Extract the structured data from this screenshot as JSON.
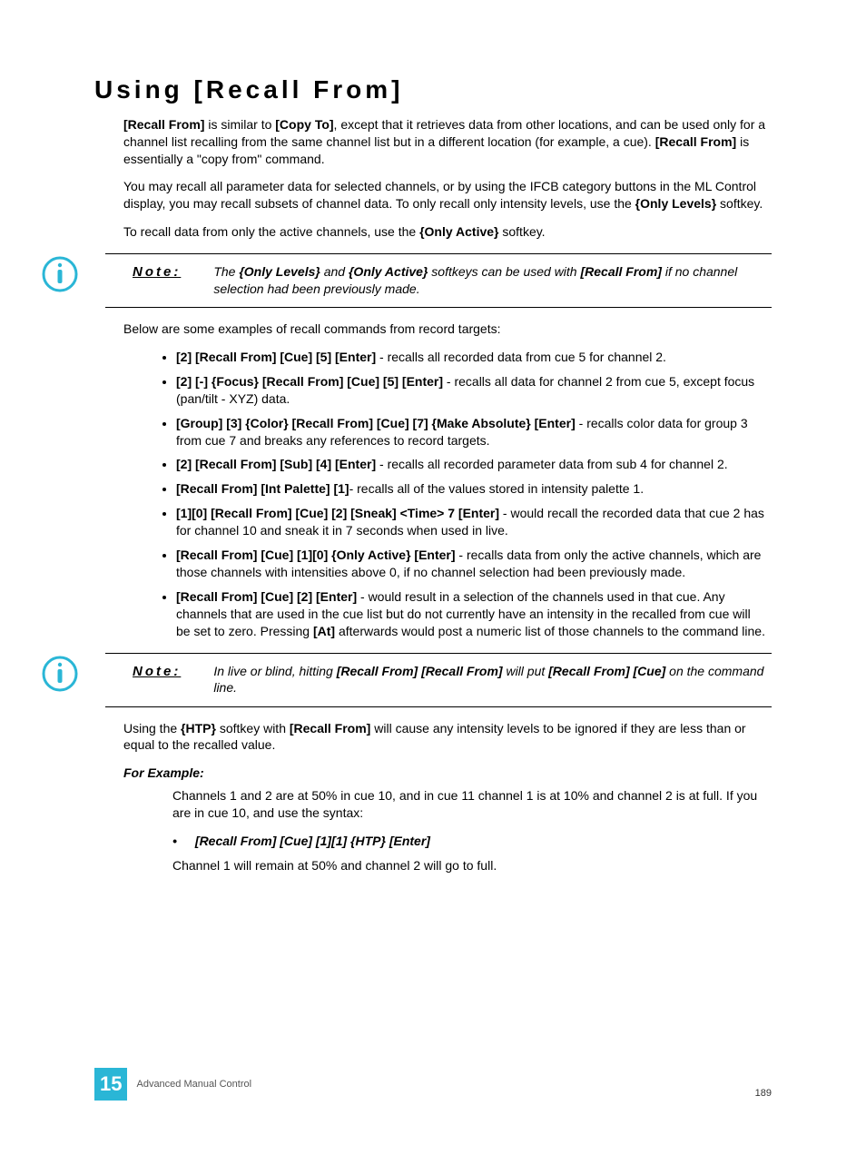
{
  "heading": "Using [Recall From]",
  "para1_parts": [
    "[Recall From]",
    " is similar to ",
    "[Copy To]",
    ", except that it retrieves data from other locations, and can be used only for a channel list recalling from the same channel list but in a different location (for example, a cue). ",
    "[Recall From]",
    " is essentially a \"copy from\" command."
  ],
  "para2_parts": [
    "You may recall all parameter data for selected channels, or by using the IFCB category buttons in the ML Control display, you may recall subsets of channel data. To only recall only intensity levels, use the ",
    "{Only Levels}",
    " softkey."
  ],
  "para3_parts": [
    "To recall data from only the active channels, use the ",
    "{Only Active}",
    " softkey."
  ],
  "note1_label": "Note:",
  "note1_parts": [
    "The ",
    "{Only Levels}",
    " and ",
    "{Only Active}",
    " softkeys can be used with ",
    "[Recall From]",
    " if no channel selection had been previously made."
  ],
  "para4": "Below are some examples of recall commands from record targets:",
  "bullets": [
    {
      "cmd": "[2] [Recall From] [Cue] [5] [Enter]",
      "desc": " - recalls all recorded data from cue 5 for channel 2."
    },
    {
      "cmd": "[2] [-] {Focus} [Recall From] [Cue] [5] [Enter]",
      "desc": " - recalls all data for channel 2 from cue 5, except focus (pan/tilt - XYZ) data."
    },
    {
      "cmd": "[Group] [3] {Color} [Recall From] [Cue] [7] {Make Absolute} [Enter]",
      "desc": " - recalls color data for group 3 from cue 7 and breaks any references to record targets."
    },
    {
      "cmd": "[2] [Recall From] [Sub] [4] [Enter]",
      "desc": " - recalls all recorded parameter data from sub 4 for channel 2."
    },
    {
      "cmd": "[Recall From] [Int Palette] [1]",
      "desc": "- recalls all of the values stored in intensity palette 1."
    },
    {
      "cmd": "[1][0] [Recall From] [Cue] [2] [Sneak] <Time> 7 [Enter]",
      "desc": " - would recall the recorded data that cue 2 has for channel 10 and sneak it in 7 seconds when used in live."
    },
    {
      "cmd": "[Recall From] [Cue] [1][0] {Only Active} [Enter]",
      "desc": " - recalls data from only the active channels, which are those channels with intensities above 0, if no channel selection had been previously made."
    },
    {
      "cmd": "[Recall From] [Cue] [2] [Enter]",
      "desc_parts": [
        " - would result in a selection of the channels used in that cue. Any channels that are used in the cue list but do not currently have an intensity in the recalled from cue will be set to zero. Pressing ",
        "[At]",
        " afterwards would post a numeric list of those channels to the command line."
      ]
    }
  ],
  "note2_label": "Note:",
  "note2_parts": [
    "In live or blind, hitting ",
    "[Recall From] [Recall From]",
    " will put ",
    "[Recall From] [Cue]",
    " on the command line."
  ],
  "para5_parts": [
    "Using the ",
    "{HTP}",
    " softkey with ",
    "[Recall From]",
    " will cause any intensity levels to be ignored if they are less than or equal to the recalled value."
  ],
  "for_example": "For Example:",
  "example_para1": "Channels 1 and 2 are at 50% in cue 10, and in cue 11 channel 1 is at 10% and channel 2 is at full. If you are in cue 10, and use the syntax:",
  "example_bullet": "[Recall From] [Cue] [1][1] {HTP} [Enter]",
  "example_para2": "Channel 1 will remain at 50% and channel 2 will go to full.",
  "footer": {
    "chapter_num": "15",
    "chapter_title": "Advanced Manual Control",
    "page_num": "189"
  }
}
